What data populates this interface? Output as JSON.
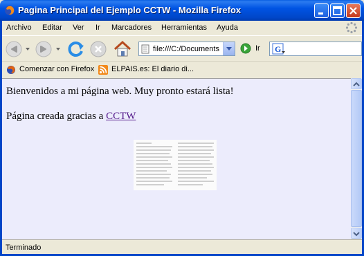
{
  "window": {
    "title": "Pagina Principal del Ejemplo CCTW - Mozilla Firefox"
  },
  "menubar": {
    "items": [
      {
        "label": "Archivo"
      },
      {
        "label": "Editar"
      },
      {
        "label": "Ver"
      },
      {
        "label": "Ir"
      },
      {
        "label": "Marcadores"
      },
      {
        "label": "Herramientas"
      },
      {
        "label": "Ayuda"
      }
    ]
  },
  "navbar": {
    "url": "file:///C:/Documents",
    "go_label": "Ir",
    "search_value": ""
  },
  "bookmarks": {
    "items": [
      {
        "label": "Comenzar con Firefox",
        "icon": "firefox-icon"
      },
      {
        "label": "ELPAIS.es: El diario di...",
        "icon": "rss-icon"
      }
    ]
  },
  "content": {
    "welcome": "Bienvenidos a mi página web. Muy pronto estará lista!",
    "created_prefix": "Página creada gracias a ",
    "link_text": "CCTW"
  },
  "status": {
    "text": "Terminado"
  },
  "colors": {
    "titlebar": "#0054e3",
    "content_bg": "#ececfc",
    "link": "#551a8b"
  }
}
